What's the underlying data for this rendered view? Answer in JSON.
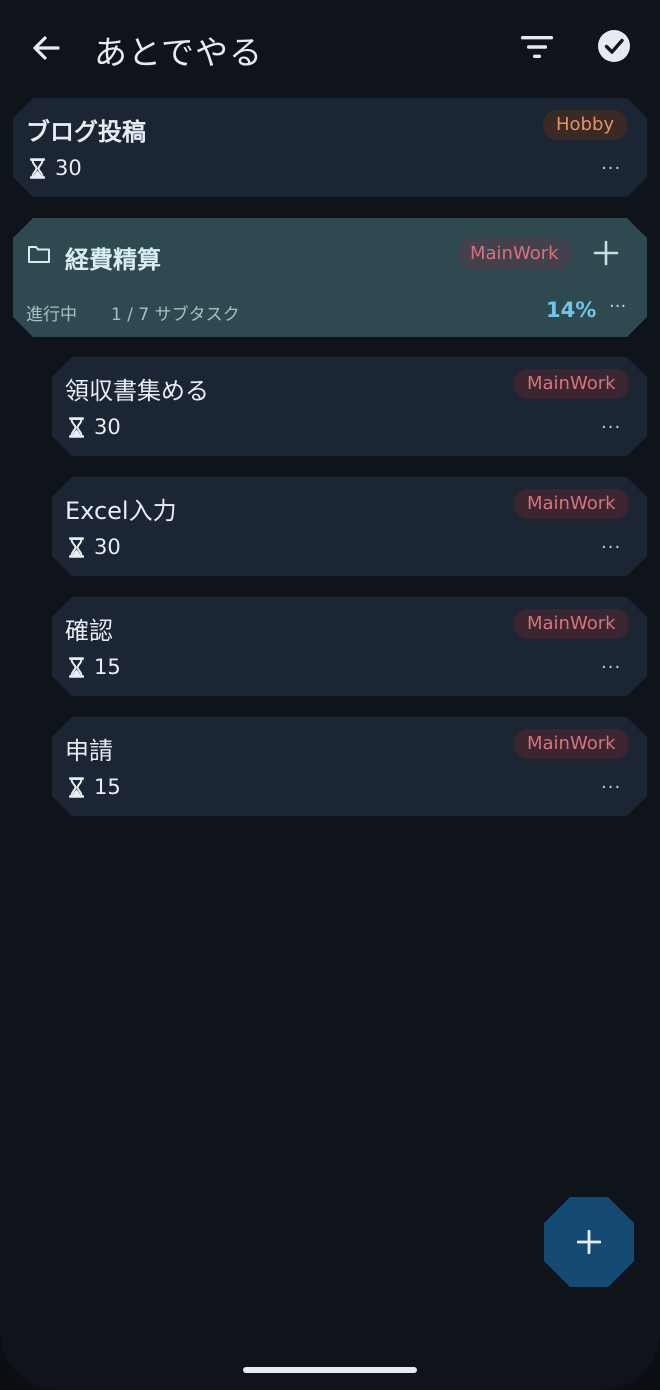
{
  "header": {
    "title": "あとでやる",
    "back_icon": "arrow-left-icon",
    "filter_icon": "filter-icon",
    "check_icon": "check-circle-icon"
  },
  "tasks": [
    {
      "title": "ブログ投稿",
      "tag": "Hobby",
      "duration": "30",
      "more": "···"
    }
  ],
  "group": {
    "title": "経費精算",
    "tag": "MainWork",
    "status": "進行中",
    "subtask_count": "1 / 7 サブタスク",
    "progress": "14%",
    "more": "···",
    "folder_icon": "folder-icon",
    "add_icon": "plus-icon"
  },
  "subtasks": [
    {
      "title": "領収書集める",
      "tag": "MainWork",
      "duration": "30",
      "more": "···"
    },
    {
      "title": "Excel入力",
      "tag": "MainWork",
      "duration": "30",
      "more": "···"
    },
    {
      "title": "確認",
      "tag": "MainWork",
      "duration": "15",
      "more": "···"
    },
    {
      "title": "申請",
      "tag": "MainWork",
      "duration": "15",
      "more": "···"
    }
  ],
  "fab": {
    "icon": "plus-icon"
  },
  "colors": {
    "background": "#0f131a",
    "card": "#1c2534",
    "group_card": "#2e4a50",
    "hobby_tag": "#e9915f",
    "mainwork_tag": "#d9727a",
    "progress": "#6fc6e8",
    "fab": "#154a73"
  }
}
